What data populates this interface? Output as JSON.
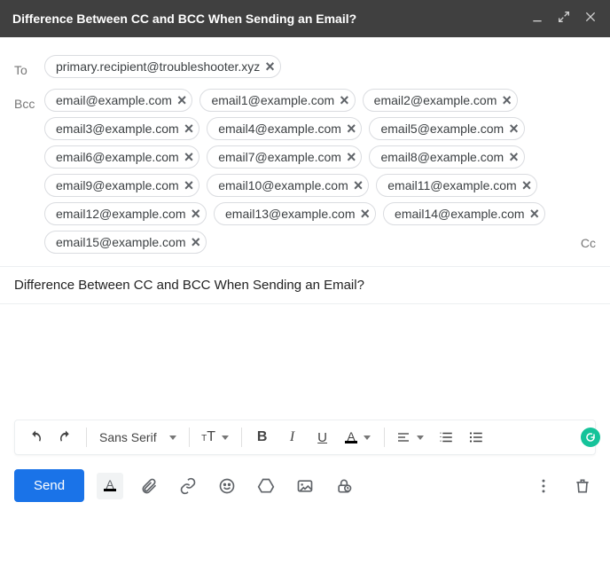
{
  "title": "Difference Between CC and BCC When Sending an Email?",
  "to_label": "To",
  "bcc_label": "Bcc",
  "cc_label": "Cc",
  "to_recipients": [
    "primary.recipient@troubleshooter.xyz"
  ],
  "bcc_recipients": [
    "email@example.com",
    "email1@example.com",
    "email2@example.com",
    "email3@example.com",
    "email4@example.com",
    "email5@example.com",
    "email6@example.com",
    "email7@example.com",
    "email8@example.com",
    "email9@example.com",
    "email10@example.com",
    "email11@example.com",
    "email12@example.com",
    "email13@example.com",
    "email14@example.com",
    "email15@example.com"
  ],
  "subject": "Difference Between CC and BCC When Sending an Email?",
  "toolbar": {
    "font_family": "Sans Serif",
    "bold_glyph": "B",
    "italic_glyph": "I",
    "underline_glyph": "U",
    "color_glyph": "A",
    "format_a_glyph": "A"
  },
  "send_label": "Send"
}
